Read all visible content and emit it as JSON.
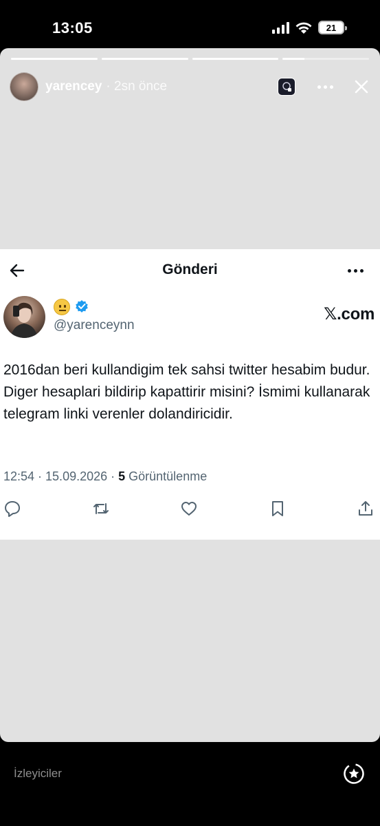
{
  "status_bar": {
    "time": "13:05",
    "battery": "21"
  },
  "story": {
    "progress": [
      1.0,
      1.0,
      1.0,
      0.25
    ],
    "username": "yarencey",
    "time_ago": "· 2sn önce",
    "icons": {
      "music": "music-sticker-icon",
      "more": "more-horizontal-icon",
      "close": "close-icon"
    }
  },
  "tweet": {
    "header_title": "Gönderi",
    "author_emoji": "neutral-face-emoji",
    "handle": "@yarenceynn",
    "brand": "𝕏.com",
    "text": "2016dan beri kullandigim tek sahsi twitter hesabim budur. Diger hesaplari bildirip kapattirir misini? İsmimi kullanarak telegram linki verenler dolandiricidir.",
    "timestamp": "12:54 · 15.09.2026 ·",
    "views_count": "5",
    "views_label": "Görüntülenme",
    "actions": [
      "reply-icon",
      "retweet-icon",
      "like-icon",
      "bookmark-icon",
      "share-icon"
    ]
  },
  "bottom": {
    "viewers_label": "İzleyiciler"
  },
  "colors": {
    "story_bg": "#e1e1e1",
    "verified_blue": "#1d9bf0",
    "secondary_text": "#536471"
  }
}
